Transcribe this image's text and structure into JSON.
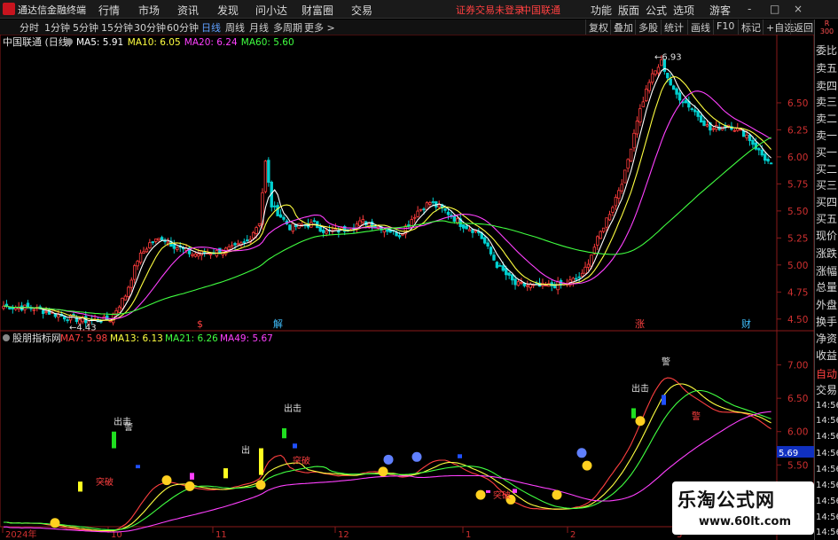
{
  "window": {
    "title": "通达信金融终端",
    "menus": [
      "行情",
      "市场",
      "资讯",
      "发现",
      "问小达",
      "财富圈",
      "交易"
    ],
    "warning": "证券交易未登录",
    "stock_name_top": "中国联通",
    "right_menus": [
      "功能",
      "版面",
      "公式",
      "选项"
    ],
    "guest": "游客",
    "controls": [
      "-",
      "□",
      "×"
    ]
  },
  "toolbar": {
    "periods": [
      "分时",
      "1分钟",
      "5分钟",
      "15分钟",
      "30分钟",
      "60分钟",
      "日线",
      "周线",
      "月线",
      "多周期",
      "更多 >"
    ],
    "active": "日线",
    "right_tools": [
      "复权",
      "叠加",
      "多股",
      "统计",
      "画线",
      "F10",
      "标记",
      "+自选",
      "返回"
    ]
  },
  "side_panel": {
    "top": [
      "R",
      "300"
    ],
    "items": [
      "委比",
      "卖五",
      "卖四",
      "卖三",
      "卖二",
      "卖一",
      "买一",
      "买二",
      "买三",
      "买四",
      "买五",
      "现价",
      "涨跌",
      "涨幅",
      "总量",
      "外盘",
      "换手",
      "净资",
      "收益",
      "自动",
      "交易",
      "14:56",
      "14:56",
      "14:56",
      "14:56",
      "14:56",
      "14:56",
      "14:56",
      "14:56",
      "14:56"
    ]
  },
  "main_chart": {
    "legend_title": "中国联通 (日线)",
    "ma_labels": [
      {
        "text": "MA5: 5.91",
        "color": "#ffffff"
      },
      {
        "text": "MA10: 6.05",
        "color": "#ffff40"
      },
      {
        "text": "MA20: 6.24",
        "color": "#ff40ff"
      },
      {
        "text": "MA60: 5.60",
        "color": "#40ff40"
      }
    ],
    "y_ticks": [
      "6.50",
      "6.25",
      "6.00",
      "5.75",
      "5.50",
      "5.25",
      "5.00",
      "4.75",
      "4.50"
    ],
    "y_range": [
      4.4,
      7.0
    ],
    "high_label": "6.93",
    "low_label": "4.43",
    "event_markers": [
      {
        "text": "$",
        "color": "#ff4040"
      },
      {
        "text": "解",
        "color": "#40c0ff"
      },
      {
        "text": "涨",
        "color": "#ff4040"
      },
      {
        "text": "财",
        "color": "#40c0ff"
      }
    ]
  },
  "sub_chart": {
    "indicator_name": "股朋指标网",
    "ma_labels": [
      {
        "text": "MA7: 5.98",
        "color": "#ff4040"
      },
      {
        "text": "MA13: 6.13",
        "color": "#ffff40"
      },
      {
        "text": "MA21: 6.26",
        "color": "#40ff40"
      },
      {
        "text": "MA49: 5.67",
        "color": "#ff40ff"
      }
    ],
    "y_ticks": [
      "7.00",
      "6.50",
      "6.00",
      "5.50",
      "5.00"
    ],
    "y_range": [
      4.6,
      7.3
    ],
    "current_value": "5.69",
    "signal_labels": [
      "突破",
      "警",
      "出击",
      "出",
      "突破",
      "出击",
      "警",
      "出击",
      "突破",
      "警"
    ]
  },
  "time_axis": [
    "2024年",
    "10",
    "11",
    "12",
    "1",
    "2",
    "3"
  ],
  "watermark": {
    "line1": "乐淘公式网",
    "line2": "www.60lt.com"
  },
  "colors": {
    "up": "#ff3c3c",
    "down": "#00d0d0",
    "ma5": "#ffffff",
    "ma10": "#ffff40",
    "ma20": "#ff40ff",
    "ma60": "#40ff40",
    "grid": "#8a1a1a"
  }
}
